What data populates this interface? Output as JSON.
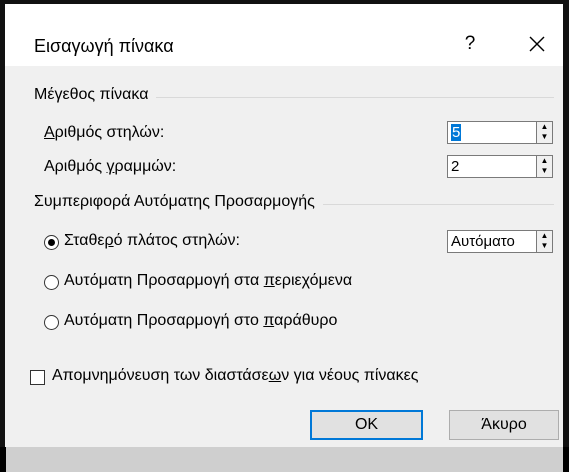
{
  "dialog": {
    "title": "Εισαγωγή πίνακα",
    "help_label": "?",
    "close_icon": "close-icon"
  },
  "table_size": {
    "group_label": "Μέγεθος πίνακα",
    "columns_label_u": "Α",
    "columns_label_rest": "ριθμός στηλών:",
    "columns_value": "5",
    "rows_label_pre": "Αριθμός ",
    "rows_label_u": "γ",
    "rows_label_rest": "ραμμών:",
    "rows_value": "2"
  },
  "autofit": {
    "group_label": "Συμπεριφορά Αυτόματης Προσαρμογής",
    "fixed_pre": "Σταθε",
    "fixed_u": "ρ",
    "fixed_rest": "ό πλάτος στηλών:",
    "fixed_value": "Αυτόματο",
    "contents_pre": "Αυτόματη Προσαρμογή στα ",
    "contents_u": "π",
    "contents_rest": "εριεχόμενα",
    "window_pre": "Αυτόματη Προσαρμογή στο ",
    "window_u": "π",
    "window_rest": "αράθυρο",
    "selected": "fixed"
  },
  "remember": {
    "pre": "Απομνημόνευση των διαστάσε",
    "u": "ω",
    "rest": "ν για νέους πίνακες",
    "checked": false
  },
  "buttons": {
    "ok": "OK",
    "cancel": "Άκυρο"
  },
  "colors": {
    "accent": "#0078d7",
    "dialog_bg": "#f0f0f0"
  }
}
